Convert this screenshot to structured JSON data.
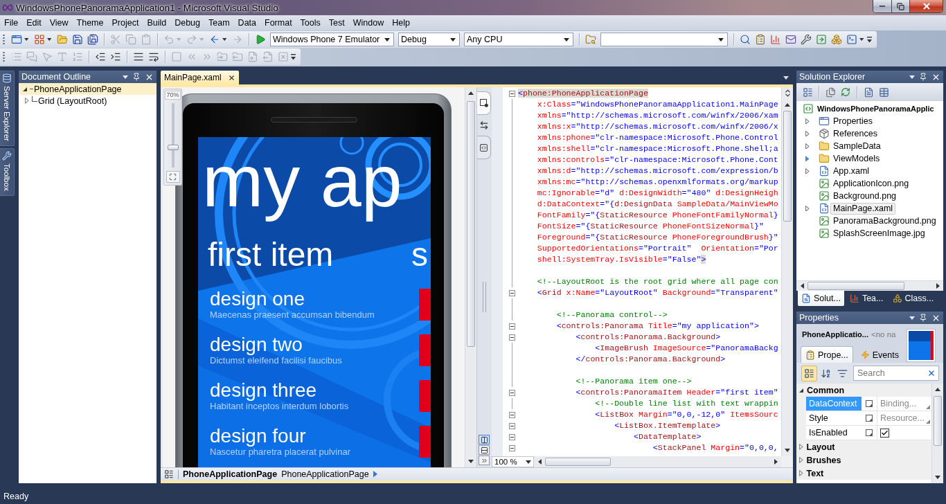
{
  "window": {
    "title": "WindowsPhonePanoramaApplication1 - Microsoft Visual Studio"
  },
  "menu": [
    "File",
    "Edit",
    "View",
    "Theme",
    "Project",
    "Build",
    "Debug",
    "Team",
    "Data",
    "Format",
    "Tools",
    "Test",
    "Window",
    "Help"
  ],
  "toolbars": [
    {
      "groups": [
        [
          {
            "kind": "new-project",
            "disabled": false,
            "dropdown": true
          },
          {
            "kind": "add-item",
            "disabled": false,
            "dropdown": true
          },
          {
            "kind": "open",
            "disabled": false,
            "dropdown": false
          },
          {
            "kind": "save",
            "disabled": false,
            "dropdown": false
          },
          {
            "kind": "save-all",
            "disabled": false,
            "dropdown": false
          }
        ],
        [
          {
            "kind": "cut",
            "disabled": true,
            "dropdown": false
          },
          {
            "kind": "copy",
            "disabled": true,
            "dropdown": false
          },
          {
            "kind": "paste",
            "disabled": true,
            "dropdown": false
          }
        ],
        [
          {
            "kind": "undo",
            "disabled": true,
            "dropdown": true
          },
          {
            "kind": "redo",
            "disabled": true,
            "dropdown": true
          },
          {
            "kind": "navigate-backward",
            "disabled": false,
            "dropdown": true
          },
          {
            "kind": "navigate-forward",
            "disabled": true,
            "dropdown": false
          }
        ],
        [
          {
            "kind": "start",
            "disabled": false,
            "dropdown": false
          },
          {
            "kind": "combo",
            "value": "Windows Phone 7 Emulator",
            "disabled": false
          },
          {
            "kind": "combo",
            "value": "Debug",
            "disabled": false
          },
          {
            "kind": "combo",
            "value": "Any CPU",
            "disabled": false
          }
        ],
        [
          {
            "kind": "find-in-files",
            "disabled": false,
            "dropdown": false
          },
          {
            "kind": "combo",
            "disabled": false
          }
        ],
        [
          {
            "kind": "find-symbol",
            "disabled": false,
            "dropdown": false
          },
          {
            "kind": "properties-window",
            "disabled": false,
            "dropdown": false
          },
          {
            "kind": "object-browser",
            "disabled": false,
            "dropdown": false
          },
          {
            "kind": "toolbox",
            "disabled": false,
            "dropdown": false
          },
          {
            "kind": "extension-manager",
            "disabled": false,
            "dropdown": false
          },
          {
            "kind": "start-page",
            "disabled": false,
            "dropdown": false
          },
          {
            "kind": "class-view",
            "disabled": false,
            "dropdown": false
          },
          {
            "kind": "command-window",
            "disabled": false,
            "dropdown": true
          }
        ]
      ]
    },
    {
      "groups": [
        [
          {
            "kind": "member-list",
            "disabled": true,
            "dropdown": false
          },
          {
            "kind": "parameter-info",
            "disabled": true,
            "dropdown": false
          },
          {
            "kind": "quick-info",
            "disabled": true,
            "dropdown": false
          },
          {
            "kind": "complete-word",
            "disabled": true,
            "dropdown": false
          },
          {
            "kind": "display-word",
            "disabled": true,
            "dropdown": false
          }
        ],
        [
          {
            "kind": "outdent",
            "disabled": false,
            "dropdown": false
          },
          {
            "kind": "indent",
            "disabled": false,
            "dropdown": false
          }
        ],
        [
          {
            "kind": "comment",
            "disabled": false,
            "dropdown": false
          },
          {
            "kind": "uncomment",
            "disabled": false,
            "dropdown": false
          }
        ],
        [
          {
            "kind": "toggle-bookmark",
            "disabled": true,
            "dropdown": false
          },
          {
            "kind": "previous-bookmark",
            "disabled": true,
            "dropdown": false
          },
          {
            "kind": "next-bookmark",
            "disabled": true,
            "dropdown": false
          },
          {
            "kind": "previous-bookmark-in-folder",
            "disabled": true,
            "dropdown": false
          },
          {
            "kind": "next-bookmark-in-folder",
            "disabled": true,
            "dropdown": false
          },
          {
            "kind": "previous-bookmark-in-document",
            "disabled": true,
            "dropdown": false
          },
          {
            "kind": "next-bookmark-in-document",
            "disabled": true,
            "dropdown": false
          },
          {
            "kind": "clear-bookmarks",
            "disabled": true,
            "dropdown": false
          }
        ]
      ]
    }
  ],
  "side_tabs": [
    {
      "label": "Server Explorer",
      "kind": "server"
    },
    {
      "label": "Toolbox",
      "kind": "toolbox"
    }
  ],
  "document_outline": {
    "title": "Document Outline",
    "tree": [
      {
        "label": "PhoneApplicationPage",
        "expanded": true,
        "selected": true,
        "children": [
          {
            "label": "Grid (LayoutRoot)",
            "expanded": false,
            "selected": false
          }
        ]
      }
    ]
  },
  "editor": {
    "tabs": [
      {
        "label": "MainPage.xaml",
        "selected": true
      }
    ],
    "zoom": {
      "label": "70%",
      "level": 0.3
    },
    "phone": {
      "title": "my ap",
      "headers": [
        "first item",
        "s"
      ],
      "items": [
        {
          "title": "design one",
          "subtitle": "Maecenas praesent accumsan bibendum"
        },
        {
          "title": "design two",
          "subtitle": "Dictumst eleifend facilisi faucibus"
        },
        {
          "title": "design three",
          "subtitle": "Habitant inceptos interdum lobortis"
        },
        {
          "title": "design four",
          "subtitle": "Nascetur pharetra placerat pulvinar"
        }
      ]
    },
    "pane_tabs": [
      {
        "kind": "design",
        "selected": true
      },
      {
        "kind": "xaml",
        "selected": false
      }
    ],
    "split_buttons": [
      {
        "kind": "vertical-split",
        "selected": true
      },
      {
        "kind": "horizontal-split",
        "selected": false
      },
      {
        "kind": "collapse-pane",
        "selected": false
      }
    ],
    "code_lines": [
      {
        "kind": "code",
        "fold": true,
        "segments": [
          {
            "kind": "markup",
            "text": "<",
            "highlight": true
          },
          {
            "kind": "element",
            "text": "phone:PhoneApplicationPage",
            "highlight": true
          }
        ]
      },
      {
        "kind": "code",
        "fold": false,
        "segments": [
          {
            "kind": "attr",
            "text": "    x:Class"
          },
          {
            "kind": "value",
            "text": "=\"WindowsPhonePanoramaApplication1.MainPage"
          }
        ]
      },
      {
        "kind": "code",
        "fold": false,
        "segments": [
          {
            "kind": "attr",
            "text": "    xmlns"
          },
          {
            "kind": "value",
            "text": "=\"http://schemas.microsoft.com/winfx/2006/xam"
          }
        ]
      },
      {
        "kind": "code",
        "fold": false,
        "segments": [
          {
            "kind": "attr",
            "text": "    xmlns:x"
          },
          {
            "kind": "value",
            "text": "=\"http://schemas.microsoft.com/winfx/2006/x"
          }
        ]
      },
      {
        "kind": "code",
        "fold": false,
        "segments": [
          {
            "kind": "attr",
            "text": "    xmlns:phone"
          },
          {
            "kind": "value",
            "text": "=\"clr-namespace:Microsoft.Phone.Control"
          }
        ]
      },
      {
        "kind": "code",
        "fold": false,
        "segments": [
          {
            "kind": "attr",
            "text": "    xmlns:shell"
          },
          {
            "kind": "value",
            "text": "=\"clr-namespace:Microsoft.Phone.Shell;a"
          }
        ]
      },
      {
        "kind": "code",
        "fold": false,
        "segments": [
          {
            "kind": "attr",
            "text": "    xmlns:controls"
          },
          {
            "kind": "value",
            "text": "=\"clr-namespace:Microsoft.Phone.Cont"
          }
        ]
      },
      {
        "kind": "code",
        "fold": false,
        "segments": [
          {
            "kind": "attr",
            "text": "    xmlns:d"
          },
          {
            "kind": "value",
            "text": "=\"http://schemas.microsoft.com/expression/b"
          }
        ]
      },
      {
        "kind": "code",
        "fold": false,
        "segments": [
          {
            "kind": "attr",
            "text": "    xmlns:mc"
          },
          {
            "kind": "value",
            "text": "=\"http://schemas.openxmlformats.org/markup"
          }
        ]
      },
      {
        "kind": "code",
        "fold": false,
        "segments": [
          {
            "kind": "attr",
            "text": "    mc:Ignorable"
          },
          {
            "kind": "value",
            "text": "=\"d\""
          },
          {
            "kind": "attr",
            "text": " d:DesignWidth"
          },
          {
            "kind": "value",
            "text": "=\"480\""
          },
          {
            "kind": "attr",
            "text": " d:DesignHeigh"
          }
        ]
      },
      {
        "kind": "code",
        "fold": false,
        "segments": [
          {
            "kind": "attr",
            "text": "    d:DataContext"
          },
          {
            "kind": "value",
            "text": "=\"{"
          },
          {
            "kind": "element",
            "text": "d:DesignData"
          },
          {
            "kind": "attr",
            "text": " SampleData/MainViewMo"
          }
        ]
      },
      {
        "kind": "code",
        "fold": false,
        "segments": [
          {
            "kind": "attr",
            "text": "    FontFamily"
          },
          {
            "kind": "value",
            "text": "=\"{"
          },
          {
            "kind": "element",
            "text": "StaticResource"
          },
          {
            "kind": "attr",
            "text": " PhoneFontFamilyNormal"
          },
          {
            "kind": "value",
            "text": "}"
          }
        ]
      },
      {
        "kind": "code",
        "fold": false,
        "segments": [
          {
            "kind": "attr",
            "text": "    FontSize"
          },
          {
            "kind": "value",
            "text": "=\"{"
          },
          {
            "kind": "element",
            "text": "StaticResource"
          },
          {
            "kind": "attr",
            "text": " PhoneFontSizeNormal"
          },
          {
            "kind": "value",
            "text": "}\""
          }
        ]
      },
      {
        "kind": "code",
        "fold": false,
        "segments": [
          {
            "kind": "attr",
            "text": "    Foreground"
          },
          {
            "kind": "value",
            "text": "=\"{"
          },
          {
            "kind": "element",
            "text": "StaticResource"
          },
          {
            "kind": "attr",
            "text": " PhoneForegroundBrush"
          },
          {
            "kind": "value",
            "text": "}\""
          }
        ]
      },
      {
        "kind": "code",
        "fold": false,
        "segments": [
          {
            "kind": "attr",
            "text": "    SupportedOrientations"
          },
          {
            "kind": "value",
            "text": "=\"Portrait\""
          },
          {
            "kind": "attr",
            "text": "  Orientation"
          },
          {
            "kind": "value",
            "text": "=\"Por"
          }
        ]
      },
      {
        "kind": "code",
        "fold": false,
        "segments": [
          {
            "kind": "attr",
            "text": "    shell:SystemTray.IsVisible"
          },
          {
            "kind": "value",
            "text": "=\"False\""
          },
          {
            "kind": "markup",
            "text": ">",
            "highlight": true
          }
        ]
      },
      {
        "kind": "blank"
      },
      {
        "kind": "code",
        "fold": false,
        "segments": [
          {
            "kind": "comment",
            "text": "    <!--LayoutRoot is the root grid where all page con"
          }
        ]
      },
      {
        "kind": "code",
        "fold": true,
        "segments": [
          {
            "kind": "markup",
            "text": "    <"
          },
          {
            "kind": "element",
            "text": "Grid"
          },
          {
            "kind": "attr",
            "text": " x:Name"
          },
          {
            "kind": "value",
            "text": "=\"LayoutRoot\""
          },
          {
            "kind": "attr",
            "text": " Background"
          },
          {
            "kind": "value",
            "text": "=\"Transparent\""
          }
        ]
      },
      {
        "kind": "blank"
      },
      {
        "kind": "code",
        "fold": false,
        "segments": [
          {
            "kind": "comment",
            "text": "        <!--Panorama control-->"
          }
        ]
      },
      {
        "kind": "code",
        "fold": true,
        "segments": [
          {
            "kind": "markup",
            "text": "        <"
          },
          {
            "kind": "element",
            "text": "controls:Panorama"
          },
          {
            "kind": "attr",
            "text": " Title"
          },
          {
            "kind": "value",
            "text": "=\"my application\">"
          }
        ]
      },
      {
        "kind": "code",
        "fold": true,
        "segments": [
          {
            "kind": "markup",
            "text": "            <"
          },
          {
            "kind": "element",
            "text": "controls:Panorama.Background"
          },
          {
            "kind": "markup",
            "text": ">"
          }
        ]
      },
      {
        "kind": "code",
        "fold": false,
        "segments": [
          {
            "kind": "markup",
            "text": "                <"
          },
          {
            "kind": "element",
            "text": "ImageBrush"
          },
          {
            "kind": "attr",
            "text": " ImageSource"
          },
          {
            "kind": "value",
            "text": "=\"PanoramaBackg"
          }
        ]
      },
      {
        "kind": "code",
        "fold": false,
        "segments": [
          {
            "kind": "markup",
            "text": "            </"
          },
          {
            "kind": "element",
            "text": "controls:Panorama.Background"
          },
          {
            "kind": "markup",
            "text": ">"
          }
        ]
      },
      {
        "kind": "blank"
      },
      {
        "kind": "code",
        "fold": false,
        "segments": [
          {
            "kind": "comment",
            "text": "            <!--Panorama item one-->"
          }
        ]
      },
      {
        "kind": "code",
        "fold": true,
        "segments": [
          {
            "kind": "markup",
            "text": "            <"
          },
          {
            "kind": "element",
            "text": "controls:PanoramaItem"
          },
          {
            "kind": "attr",
            "text": " Header"
          },
          {
            "kind": "value",
            "text": "=\"first item\""
          }
        ]
      },
      {
        "kind": "code",
        "fold": false,
        "segments": [
          {
            "kind": "comment",
            "text": "                <!--Double line list with text wrappin"
          }
        ]
      },
      {
        "kind": "code",
        "fold": true,
        "segments": [
          {
            "kind": "markup",
            "text": "                <"
          },
          {
            "kind": "element",
            "text": "ListBox"
          },
          {
            "kind": "attr",
            "text": " Margin"
          },
          {
            "kind": "value",
            "text": "=\"0,0,-12,0\""
          },
          {
            "kind": "attr",
            "text": " ItemsSourc"
          }
        ]
      },
      {
        "kind": "code",
        "fold": true,
        "segments": [
          {
            "kind": "markup",
            "text": "                    <"
          },
          {
            "kind": "element",
            "text": "ListBox.ItemTemplate"
          },
          {
            "kind": "markup",
            "text": ">"
          }
        ]
      },
      {
        "kind": "code",
        "fold": true,
        "segments": [
          {
            "kind": "markup",
            "text": "                        <"
          },
          {
            "kind": "element",
            "text": "DataTemplate"
          },
          {
            "kind": "markup",
            "text": ">"
          }
        ]
      },
      {
        "kind": "code",
        "fold": true,
        "segments": [
          {
            "kind": "markup",
            "text": "                            <"
          },
          {
            "kind": "element",
            "text": "StackPanel"
          },
          {
            "kind": "attr",
            "text": " Margin"
          },
          {
            "kind": "value",
            "text": "=\"0,0,0,"
          }
        ]
      }
    ],
    "code_zoom": "100 %",
    "breadcrumb": {
      "element": "PhoneApplicationPage",
      "type": "PhoneApplicationPage"
    }
  },
  "solution_explorer": {
    "title": "Solution Explorer",
    "tree": {
      "label": "WindowsPhonePanoramaApplic",
      "children": [
        {
          "label": "Properties",
          "kind": "properties",
          "has_children": true,
          "expanded": false,
          "hovered": false,
          "selected": false
        },
        {
          "label": "References",
          "kind": "references",
          "has_children": true,
          "expanded": false,
          "hovered": false,
          "selected": false
        },
        {
          "label": "SampleData",
          "kind": "folder",
          "has_children": true,
          "expanded": false,
          "hovered": false,
          "selected": false
        },
        {
          "label": "ViewModels",
          "kind": "folder",
          "has_children": true,
          "expanded": false,
          "hovered": true,
          "selected": false
        },
        {
          "label": "App.xaml",
          "kind": "xaml",
          "has_children": true,
          "expanded": false,
          "hovered": false,
          "selected": false
        },
        {
          "label": "ApplicationIcon.png",
          "kind": "image",
          "has_children": false,
          "selected": false
        },
        {
          "label": "Background.png",
          "kind": "image",
          "has_children": false,
          "selected": false
        },
        {
          "label": "MainPage.xaml",
          "kind": "xaml",
          "has_children": true,
          "expanded": false,
          "hovered": false,
          "selected": true
        },
        {
          "label": "PanoramaBackground.png",
          "kind": "image",
          "has_children": false,
          "selected": false
        },
        {
          "label": "SplashScreenImage.jpg",
          "kind": "image",
          "has_children": false,
          "selected": false
        }
      ]
    },
    "tabs": [
      {
        "label": "Solut...",
        "kind": "solution",
        "selected": true
      },
      {
        "label": "Tea...",
        "kind": "team",
        "selected": false
      },
      {
        "label": "Class...",
        "kind": "class",
        "selected": false
      }
    ]
  },
  "properties": {
    "title": "Properties",
    "object_name": "PhoneApplicatio...",
    "name_field": {
      "placeholder": "<no na"
    },
    "tabs": [
      {
        "label": "Prope...",
        "kind": "properties",
        "selected": true
      },
      {
        "label": "Events",
        "kind": "events",
        "selected": false
      }
    ],
    "view_buttons": [
      {
        "kind": "categorized",
        "selected": true
      },
      {
        "kind": "alphabetical",
        "selected": false
      },
      {
        "kind": "filter",
        "selected": false
      }
    ],
    "search": {
      "placeholder": "Search"
    },
    "categories": [
      {
        "name": "Common",
        "expanded": true,
        "properties": [
          {
            "name": "DataContext",
            "kind": "text",
            "value": "Binding...",
            "selected": true
          },
          {
            "name": "Style",
            "kind": "text",
            "value": "Resource...",
            "selected": false
          },
          {
            "name": "IsEnabled",
            "kind": "checkbox",
            "checked": true,
            "selected": false
          }
        ]
      },
      {
        "name": "Layout",
        "expanded": false
      },
      {
        "name": "Brushes",
        "expanded": false
      },
      {
        "name": "Text",
        "expanded": false
      }
    ]
  },
  "status_bar": {
    "text": "Ready"
  }
}
